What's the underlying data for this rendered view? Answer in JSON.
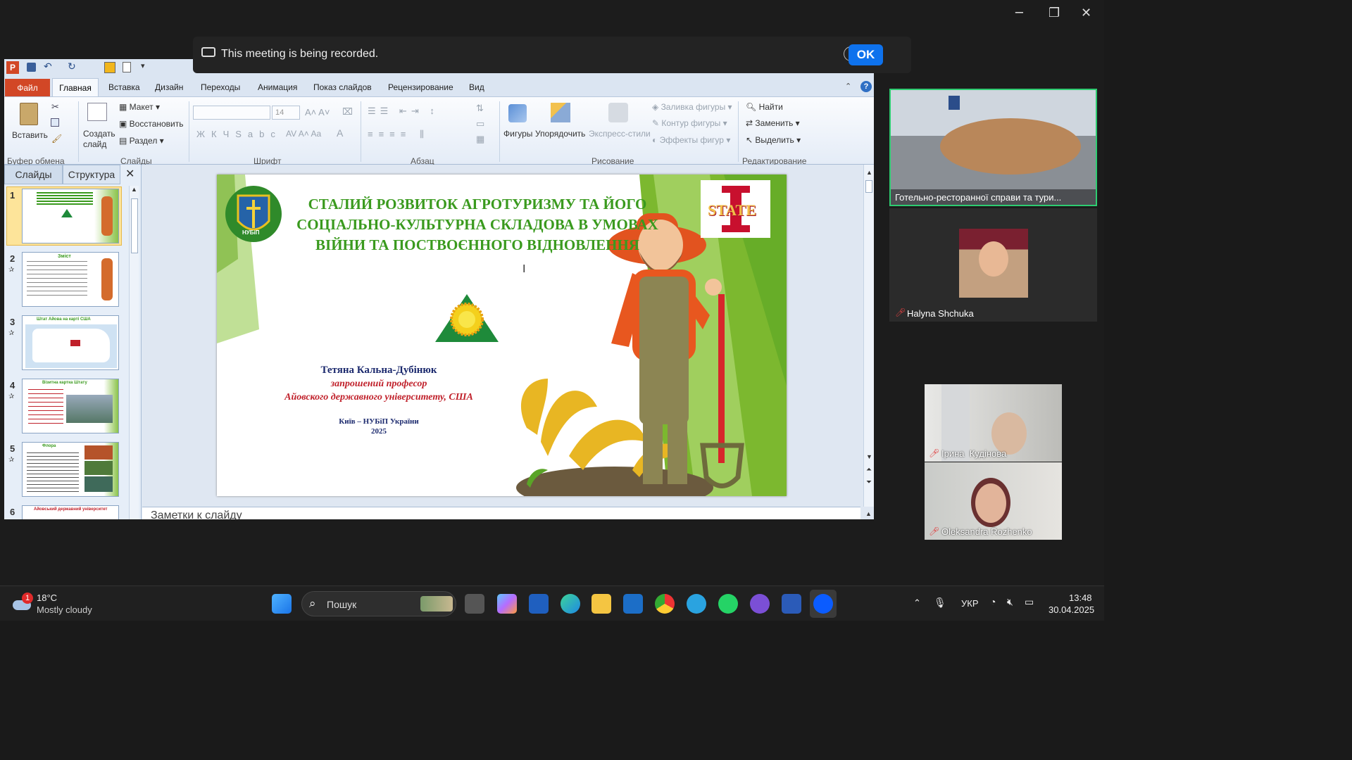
{
  "banner": {
    "text": "This meeting is being recorded.",
    "ok": "OK"
  },
  "ppt": {
    "tabs": [
      "Файл",
      "Главная",
      "Вставка",
      "Дизайн",
      "Переходы",
      "Анимация",
      "Показ слайдов",
      "Рецензирование",
      "Вид"
    ],
    "ribbon": {
      "paste": "Вставить",
      "clipboard_group": "Буфер обмена",
      "create_slide": "Создать слайд",
      "layout": "Макет",
      "reset": "Восстановить",
      "section": "Раздел",
      "slides_group": "Слайды",
      "font_size": "14",
      "font_group": "Шрифт",
      "paragraph_group": "Абзац",
      "shapes": "Фигуры",
      "arrange": "Упорядочить",
      "quick_styles": "Экспресс-стили",
      "shape_fill": "Заливка фигуры",
      "shape_outline": "Контур фигуры",
      "shape_effects": "Эффекты фигур",
      "drawing_group": "Рисование",
      "find": "Найти",
      "replace": "Заменить",
      "select": "Выделить",
      "editing_group": "Редактирование"
    },
    "pane_tabs": [
      "Слайды",
      "Структура"
    ],
    "slide_numbers": [
      "1",
      "2",
      "3",
      "4",
      "5",
      "6"
    ],
    "thumbs": {
      "t2": "Зміст",
      "t3": "Штат Айова на карті США",
      "t4": "Візитна картка Штату",
      "t5": "Флора",
      "t6": "Айовський державний університет"
    },
    "slide": {
      "title": "СТАЛИЙ РОЗВИТОК АГРОТУРИЗМУ ТА ЙОГО СОЦІАЛЬНО-КУЛЬТУРНА СКЛАДОВА В УМОВАХ ВІЙНИ ТА ПОСТВОЄННОГО ВІДНОВЛЕННЯ",
      "author": "Тетяна Кальна-Дубінюк",
      "role": "запрошений професор",
      "univ": "Айовского державного університету, США",
      "city": "Київ – НУБіП України",
      "year": "2025",
      "logo_text": "STATE",
      "uni_label": "НУБіП"
    },
    "notes": "Заметки к слайду"
  },
  "participants": [
    {
      "name": "Готельно-ресторанної справи та тури..."
    },
    {
      "name": "Halyna Shchuka"
    },
    {
      "name": "Ірина  Кудінова"
    },
    {
      "name": "Oleksandra Rozhenko"
    }
  ],
  "taskbar": {
    "temp": "18°C",
    "weather": "Mostly cloudy",
    "weather_badge": "1",
    "search": "Пошук",
    "lang": "УКР",
    "time": "13:48",
    "date": "30.04.2025"
  },
  "colors": {
    "accent": "#0e72ed",
    "ppt_file": "#d24726",
    "speaker_border": "#2ecc71",
    "title_green": "#3a9a1e"
  }
}
